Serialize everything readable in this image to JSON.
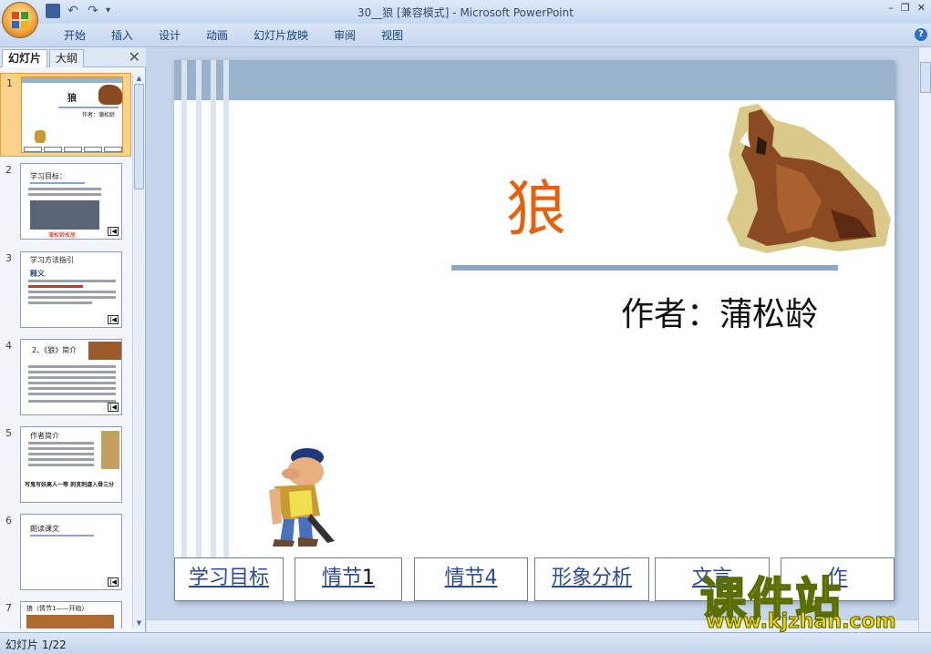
{
  "window": {
    "title": "30__狼 [兼容模式] - Microsoft PowerPoint"
  },
  "ribbon": {
    "tabs": [
      "开始",
      "插入",
      "设计",
      "动画",
      "幻灯片放映",
      "审阅",
      "视图"
    ]
  },
  "pane": {
    "tabs": [
      "幻灯片",
      "大纲"
    ],
    "slides": [
      {
        "num": "1",
        "title": "狼",
        "sub": "作者：蒲松龄"
      },
      {
        "num": "2",
        "title": "学习目标：",
        "sub": "蒲松龄故居"
      },
      {
        "num": "3",
        "title": "学习方法指引",
        "sub": "释义"
      },
      {
        "num": "4",
        "title": "2、《狼》简介",
        "sub": ""
      },
      {
        "num": "5",
        "title": "作者简介",
        "sub": "写鬼写妖高人一等 刺贪刺虐入骨三分"
      },
      {
        "num": "6",
        "title": "朗读课文",
        "sub": ""
      },
      {
        "num": "7",
        "title": "狼（情节1——开始）",
        "sub": ""
      }
    ]
  },
  "slide": {
    "title": "狼",
    "author": "作者：蒲松龄",
    "buttons": [
      {
        "label": "学习目标"
      },
      {
        "label": "情节",
        "suffix": "1"
      },
      {
        "label": "情节4"
      },
      {
        "label": "形象分析"
      },
      {
        "label": "文言"
      },
      {
        "label": "作"
      }
    ]
  },
  "watermark": {
    "text": "课件站",
    "url": "www.kjzhan.com"
  },
  "status": {
    "text": "幻灯片 1/22"
  }
}
